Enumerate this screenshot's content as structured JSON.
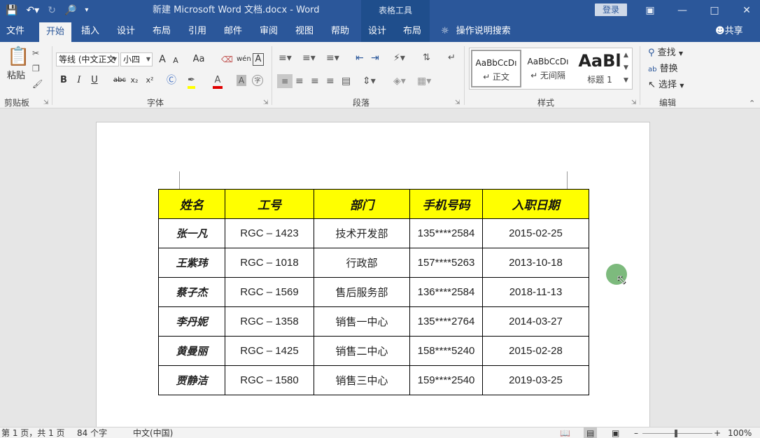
{
  "titlebar": {
    "document_title": "新建 Microsoft Word 文档.docx  -  Word",
    "context_tools": "表格工具",
    "login_label": "登录",
    "save_icon": "save-icon",
    "undo_icon": "undo-icon",
    "redo_icon": "redo-icon",
    "print_preview_icon": "print-preview-icon"
  },
  "tabs": {
    "file": "文件",
    "home": "开始",
    "insert": "插入",
    "design": "设计",
    "layout": "布局",
    "references": "引用",
    "mailings": "邮件",
    "review": "审阅",
    "view": "视图",
    "help": "帮助",
    "table_design": "设计",
    "table_layout": "布局",
    "search": "操作说明搜索",
    "share": "共享"
  },
  "ribbon": {
    "clipboard": {
      "label": "剪贴板",
      "paste": "粘贴"
    },
    "font": {
      "label": "字体",
      "font_name": "等线 (中文正文",
      "font_size": "小四",
      "grow": "A",
      "shrink": "A",
      "change_case": "Aa",
      "phonetic": "wén",
      "char_border": "A",
      "bold": "B",
      "italic": "I",
      "underline": "U",
      "strike": "abc",
      "subscript": "x₂",
      "superscript": "x²"
    },
    "paragraph": {
      "label": "段落"
    },
    "styles": {
      "label": "样式",
      "items": [
        {
          "sample": "AaBbCcDı",
          "name": "↵ 正文"
        },
        {
          "sample": "AaBbCcDı",
          "name": "↵ 无间隔"
        },
        {
          "sample": "AaBl",
          "name": "标题 1"
        }
      ]
    },
    "editing": {
      "label": "编辑",
      "find": "查找",
      "replace": "替换",
      "select": "选择"
    }
  },
  "table": {
    "headers": [
      "姓名",
      "工号",
      "部门",
      "手机号码",
      "入职日期"
    ],
    "rows": [
      [
        "张一凡",
        "RGC – 1423",
        "技术开发部",
        "135****2584",
        "2015-02-25"
      ],
      [
        "王紫玮",
        "RGC – 1018",
        "行政部",
        "157****5263",
        "2013-10-18"
      ],
      [
        "蔡子杰",
        "RGC – 1569",
        "售后服务部",
        "136****2584",
        "2018-11-13"
      ],
      [
        "李丹妮",
        "RGC – 1358",
        "销售一中心",
        "135****2764",
        "2014-03-27"
      ],
      [
        "黄曼丽",
        "RGC – 1425",
        "销售二中心",
        "158****5240",
        "2015-02-28"
      ],
      [
        "贾静洁",
        "RGC – 1580",
        "销售三中心",
        "159****2540",
        "2019-03-25"
      ]
    ]
  },
  "statusbar": {
    "page": "第 1 页，共 1 页",
    "words": "84 个字",
    "language": "中文(中国)",
    "zoom": "100%"
  },
  "colors": {
    "brand": "#2b579a",
    "header_fill": "#ffff00",
    "cursor": "#6fb36f"
  }
}
